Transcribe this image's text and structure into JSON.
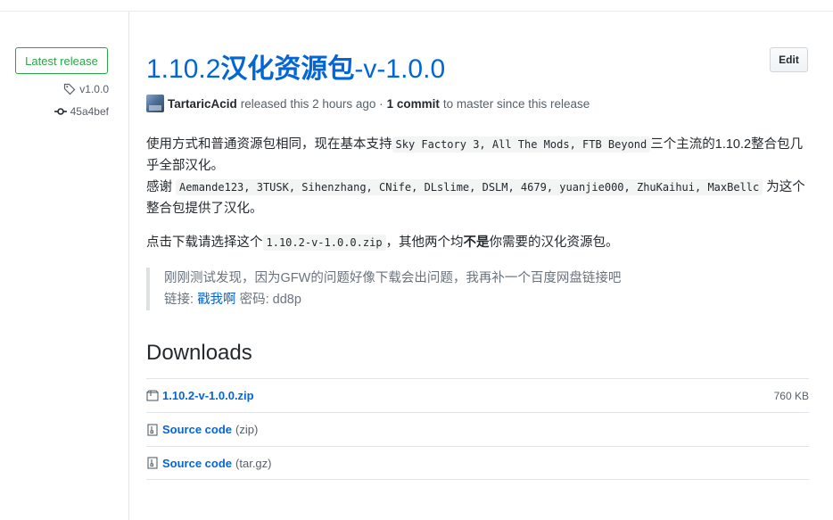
{
  "release": {
    "badge": "Latest release",
    "tag": "v1.0.0",
    "commit_sha": "45a4bef",
    "edit_label": "Edit",
    "title_version": "1.10.2",
    "title_cn": "汉化资源包",
    "title_suffix": "-v-1.0.0",
    "author": "TartaricAcid",
    "released_text": "released this 2 hours ago ·",
    "commit_count": "1 commit",
    "commit_text": "to master since this release"
  },
  "body": {
    "line1_a": "使用方式和普通资源包相同，现在基本支持",
    "line1_code": "Sky Factory 3, All The Mods, FTB Beyond",
    "line1_b": "三个主流的1.10.2整合包几乎全部汉化。",
    "line2_a": "感谢",
    "line2_code": "Aemande123, 3TUSK, Sihenzhang, CNife, DLslime, DSLM, 4679, yuanjie000, ZhuKaihui, MaxBellc",
    "line2_b": "为这个整合包提供了汉化。",
    "line3_a": "点击下载请选择这个",
    "line3_code": "1.10.2-v-1.0.0.zip",
    "line3_b": "，其他两个均",
    "line3_bold": "不是",
    "line3_c": "你需要的汉化资源包。",
    "quote_line1": "刚刚测试发现，因为GFW的问题好像下载会出问题，我再补一个百度网盘链接吧",
    "quote_label": "链接:",
    "quote_link": "戳我啊",
    "quote_pwd": "密码: dd8p"
  },
  "downloads": {
    "heading": "Downloads",
    "items": [
      {
        "name": "1.10.2-v-1.0.0.zip",
        "ext": "",
        "size": "760 KB",
        "icon": "package-icon"
      },
      {
        "name": "Source code",
        "ext": "(zip)",
        "size": "",
        "icon": "file-zip-icon"
      },
      {
        "name": "Source code",
        "ext": "(tar.gz)",
        "size": "",
        "icon": "file-zip-icon"
      }
    ]
  },
  "colors": {
    "link": "#0366d6",
    "badge_green": "#28a745"
  }
}
